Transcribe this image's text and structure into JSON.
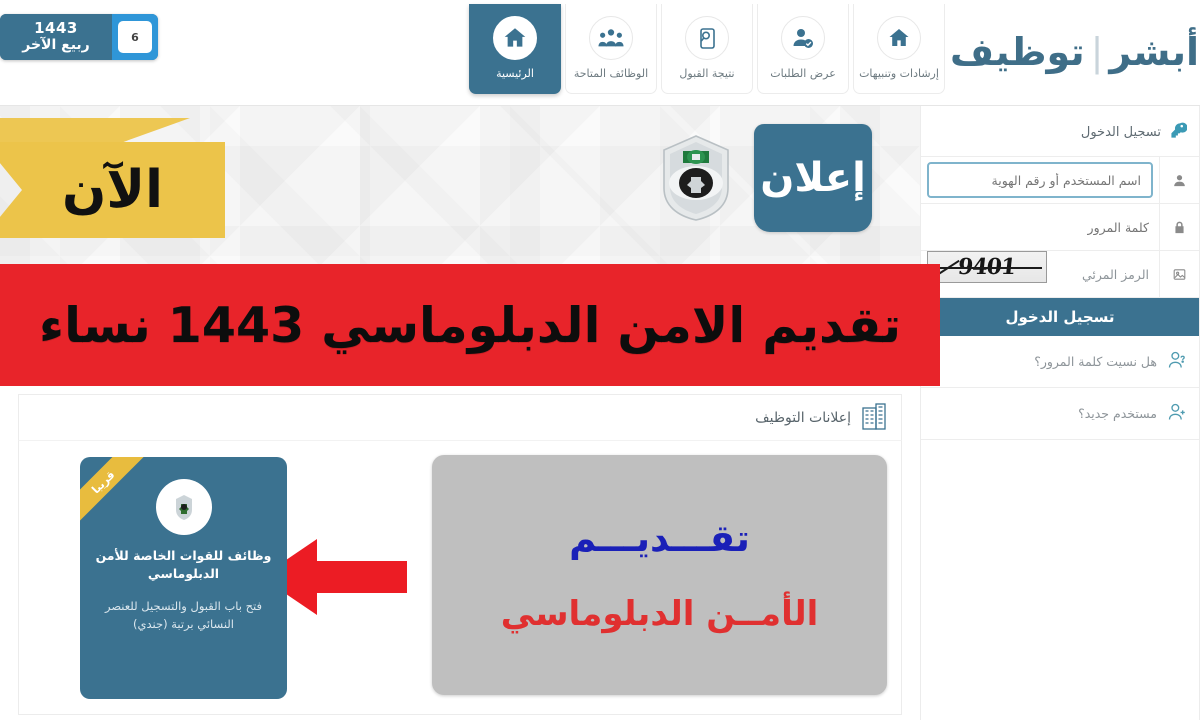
{
  "header": {
    "date_badge": {
      "day": "6",
      "year": "1443",
      "month": "ربيع الآخر"
    },
    "logo": {
      "first": "أبشر",
      "separator": "|",
      "second": "توظيف"
    },
    "nav": [
      {
        "label": "إرشادات وتنبيهات",
        "icon": "home-icon",
        "active": false
      },
      {
        "label": "عرض الطلبات",
        "icon": "user-check-icon",
        "active": false
      },
      {
        "label": "نتيجة القبول",
        "icon": "document-search-icon",
        "active": false
      },
      {
        "label": "الوظائف المتاحة",
        "icon": "group-users-icon",
        "active": false
      },
      {
        "label": "الرئيسية",
        "icon": "home-icon",
        "active": true
      }
    ]
  },
  "hero": {
    "announce_label": "إعلان",
    "emblem_name": "saudi-police-emblem",
    "now_tag": "الآن",
    "red_banner": "تقديم الامن الدبلوماسي 1443 نساء"
  },
  "login": {
    "title": "تسجيل الدخول",
    "username": {
      "placeholder": "اسم المستخدم أو رقم الهوية",
      "value": "",
      "icon": "user-icon"
    },
    "password": {
      "placeholder": "كلمة المرور",
      "value": "",
      "icon": "lock-icon"
    },
    "captcha": {
      "label": "الرمز المرئي",
      "code": "9401",
      "icon": "image-icon"
    },
    "submit_label": "تسجيل الدخول",
    "links": [
      {
        "label": "هل نسيت كلمة المرور؟",
        "icon": "user-question-icon"
      },
      {
        "label": "مستخدم جديد؟",
        "icon": "user-add-icon"
      }
    ]
  },
  "jobs": {
    "section_title": "إعلانات التوظيف",
    "section_icon": "building-icon",
    "card": {
      "ribbon": "قريبا",
      "title": "وظائف للقوات الخاصة للأمن الدبلوماسي",
      "description": "فتح باب القبول والتسجيل للعنصر النسائي برتبة (جندي)",
      "logo_name": "special-forces-emblem"
    },
    "arrow_name": "red-left-arrow",
    "panel": {
      "line1": "تقـــديـــم",
      "line2": "الأمــن الدبلوماسي"
    }
  },
  "colors": {
    "brand_blue": "#3b7290",
    "accent_yellow": "#ecc44a",
    "banner_red": "#e8242a",
    "panel_gray": "#bfbfbf",
    "text_blue": "#1a20b8",
    "text_red": "#e03030"
  }
}
